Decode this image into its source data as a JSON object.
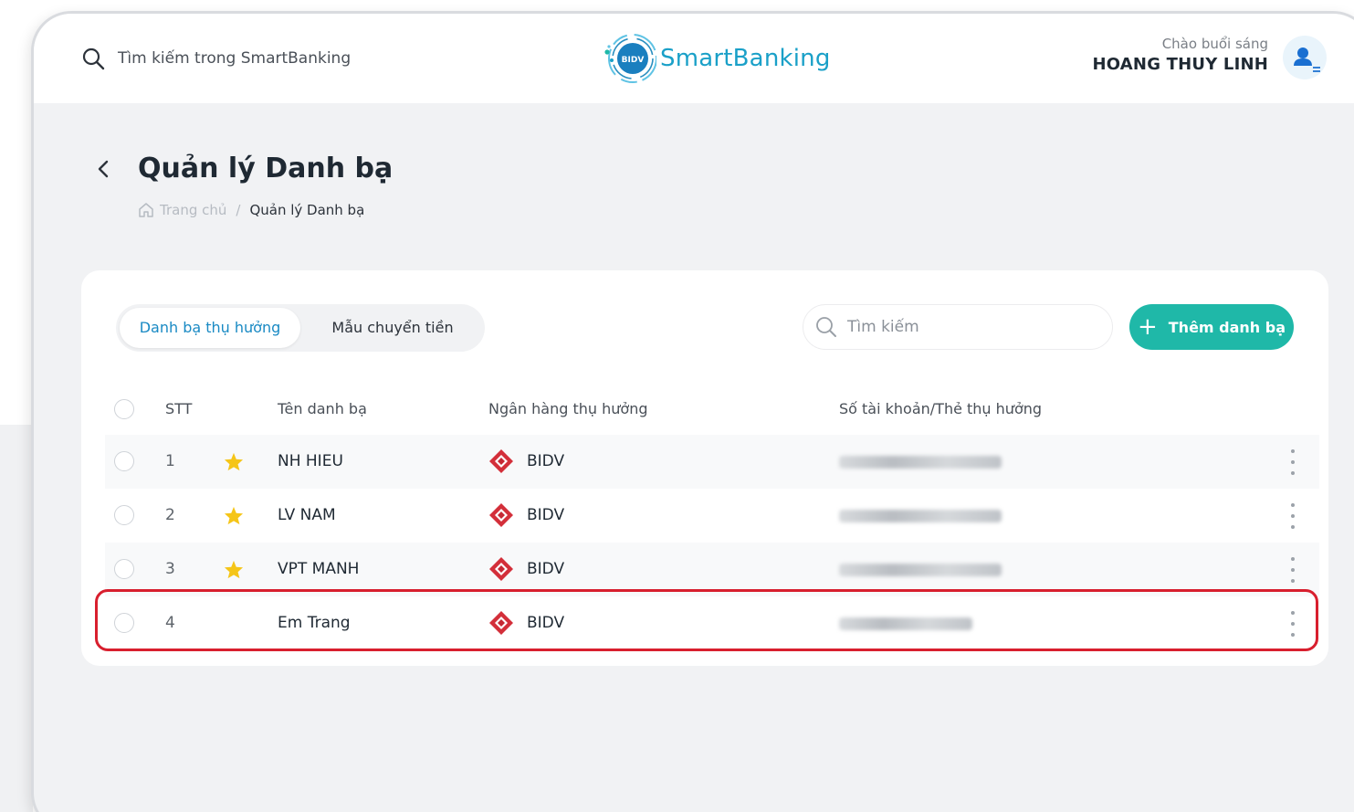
{
  "header": {
    "search_label": "Tìm kiếm trong SmartBanking",
    "logo_badge": "BIDV",
    "logo_text": "SmartBanking",
    "greeting": "Chào buổi sáng",
    "user_name": "HOANG THUY LINH"
  },
  "page": {
    "title": "Quản lý Danh bạ",
    "breadcrumb": {
      "home": "Trang chủ",
      "separator": "/",
      "current": "Quản lý Danh bạ"
    }
  },
  "tabs": [
    {
      "label": "Danh bạ thụ hưởng",
      "active": true
    },
    {
      "label": "Mẫu chuyển tiền",
      "active": false
    }
  ],
  "search": {
    "placeholder": "Tìm kiếm"
  },
  "add_button": {
    "label": "Thêm danh bạ"
  },
  "table": {
    "columns": [
      "STT",
      "Tên danh bạ",
      "Ngân hàng thụ hưởng",
      "Số tài khoản/Thẻ thụ hưởng"
    ],
    "rows": [
      {
        "stt": "1",
        "starred": true,
        "name": "NH HIEU",
        "bank": "BIDV"
      },
      {
        "stt": "2",
        "starred": true,
        "name": "LV NAM",
        "bank": "BIDV"
      },
      {
        "stt": "3",
        "starred": true,
        "name": "VPT MANH",
        "bank": "BIDV"
      },
      {
        "stt": "4",
        "starred": false,
        "name": "Em Trang",
        "bank": "BIDV"
      }
    ]
  },
  "colors": {
    "accent": "#1fb8a8",
    "tab_active": "#1a8ac4",
    "star": "#f5c518",
    "bank_logo": "#d32f3a",
    "highlight": "#d81f2e"
  },
  "icons": [
    "search-icon",
    "bidv-logo-icon",
    "user-avatar-icon",
    "back-arrow-icon",
    "home-icon",
    "plus-icon",
    "star-icon",
    "bidv-bank-icon",
    "more-vertical-icon"
  ]
}
